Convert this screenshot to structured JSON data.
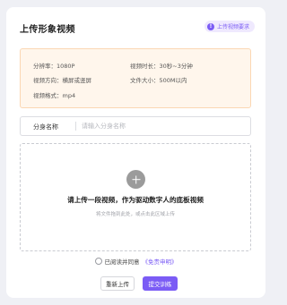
{
  "header": {
    "title": "上传形象视频",
    "requirements_button": "上传视频要求",
    "accent_color": "#7b5cf5"
  },
  "specs": {
    "resolution": "分辨率：1080P",
    "duration": "视频时长：30秒~3分钟",
    "orientation": "视频方向：横屏或竖屏",
    "file_size": "文件大小：500M以内",
    "format": "视频格式：mp4"
  },
  "name_field": {
    "label": "分身名称",
    "value": "",
    "placeholder": "请输入分身名称"
  },
  "upload": {
    "icon": "plus-icon",
    "title": "请上传一段视频，作为驱动数字人的底板视频",
    "hint": "将文件拖到此处，或点击此区域上传"
  },
  "agreement": {
    "text": "已阅读并同意",
    "link": "《免责申明》",
    "checked": false
  },
  "actions": {
    "reupload_label": "重新上传",
    "submit_label": "提交训练"
  }
}
